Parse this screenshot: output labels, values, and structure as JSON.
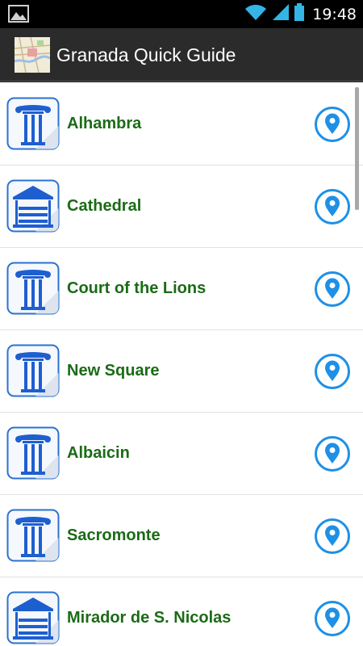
{
  "status_bar": {
    "time": "19:48"
  },
  "app": {
    "title": "Granada Quick Guide"
  },
  "places": [
    {
      "name": "Alhambra",
      "icon": "column-icon"
    },
    {
      "name": "Cathedral",
      "icon": "temple-icon"
    },
    {
      "name": "Court of the Lions",
      "icon": "column-icon"
    },
    {
      "name": "New Square",
      "icon": "column-icon"
    },
    {
      "name": "Albaicin",
      "icon": "column-icon"
    },
    {
      "name": "Sacromonte",
      "icon": "column-icon"
    },
    {
      "name": "Mirador de S. Nicolas",
      "icon": "temple-icon"
    }
  ],
  "colors": {
    "label": "#1b6b16",
    "accent_blue": "#1e90e6",
    "action_bar": "#2b2b2b"
  }
}
